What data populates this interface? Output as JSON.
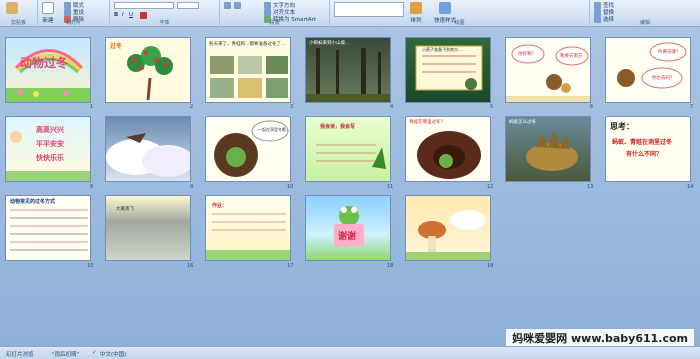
{
  "ribbon": {
    "groups": [
      {
        "label": "剪贴板"
      },
      {
        "label": "幻灯片"
      },
      {
        "label": "字体"
      },
      {
        "label": "段落"
      },
      {
        "label": "绘图"
      },
      {
        "label": "编辑"
      }
    ],
    "buttons": {
      "new_slide": "新建",
      "layout": "版式",
      "reset": "重设",
      "delete": "删除",
      "text_direction": "文字方向",
      "align_text": "对齐文本",
      "smartart": "转换为 SmartArt",
      "arrange": "排列",
      "quick_styles": "快速样式",
      "find": "查找",
      "replace": "替换",
      "select": "选择"
    }
  },
  "slides": {
    "s1": {
      "num": "1",
      "title": "动物过冬"
    },
    "s2": {
      "num": "2",
      "title": "过冬"
    },
    "s3": {
      "num": "3",
      "text": "秋天来了，青蛙和…都要准备过冬了…"
    },
    "s4": {
      "num": "4",
      "text": "小蝌蚪来到小山坡…"
    },
    "s5": {
      "num": "5",
      "text": "小燕子准备飞到南方…"
    },
    "s6": {
      "num": "6",
      "bubble1": "你好啊？",
      "bubble2": "我要去南方"
    },
    "s7": {
      "num": "7",
      "bubble1": "你要去哪？",
      "bubble2": "你也去吗？"
    },
    "s8": {
      "num": "8",
      "lines": [
        "高高兴兴",
        "平平安安",
        "快快乐乐"
      ]
    },
    "s9": {
      "num": "9"
    },
    "s10": {
      "num": "10",
      "text": "…一起在洞里冬眠…"
    },
    "s11": {
      "num": "11",
      "title": "我会读，我会写"
    },
    "s12": {
      "num": "12",
      "text": "青蛙在哪里过冬？"
    },
    "s13": {
      "num": "13",
      "title": "蚂蚁怎么过冬"
    },
    "s14": {
      "num": "14",
      "title": "思考：",
      "line1": "蚂蚁、青蛙在洞里过冬",
      "line2": "有什么不同？"
    },
    "s15": {
      "num": "15",
      "title": "动物常见的过冬方式"
    },
    "s16": {
      "num": "16",
      "title": "大雁南飞"
    },
    "s17": {
      "num": "17",
      "title": "作业："
    },
    "s18": {
      "num": "18",
      "title": "谢谢"
    },
    "s19": {
      "num": "19"
    }
  },
  "status": {
    "slide_view": "幻灯片浏览",
    "theme": "\"雨后初晴\"",
    "language": "中文(中国)"
  },
  "watermark": "妈咪爱婴网 www.baby611.com",
  "colors": {
    "workspace": "#9fbddf",
    "accent": "#1f4e8c"
  }
}
